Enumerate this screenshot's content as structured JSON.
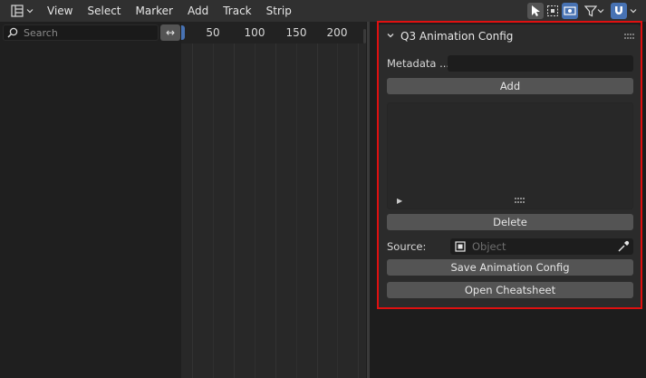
{
  "header": {
    "menu": [
      "View",
      "Select",
      "Marker",
      "Add",
      "Track",
      "Strip"
    ]
  },
  "channels": {
    "search_placeholder": "Search",
    "swap_symbol": "↔"
  },
  "timeline": {
    "ruler_labels": [
      "50",
      "100",
      "150",
      "200"
    ]
  },
  "panel": {
    "title": "Q3 Animation Config",
    "metadata_label": "Metadata ...",
    "metadata_value": "",
    "add_label": "Add",
    "delete_label": "Delete",
    "source_label": "Source:",
    "source_placeholder": "Object",
    "save_label": "Save Animation Config",
    "cheatsheet_label": "Open Cheatsheet",
    "list_expand": "▶"
  },
  "colors": {
    "accent": "#4772b3",
    "highlight": "#e01010"
  }
}
